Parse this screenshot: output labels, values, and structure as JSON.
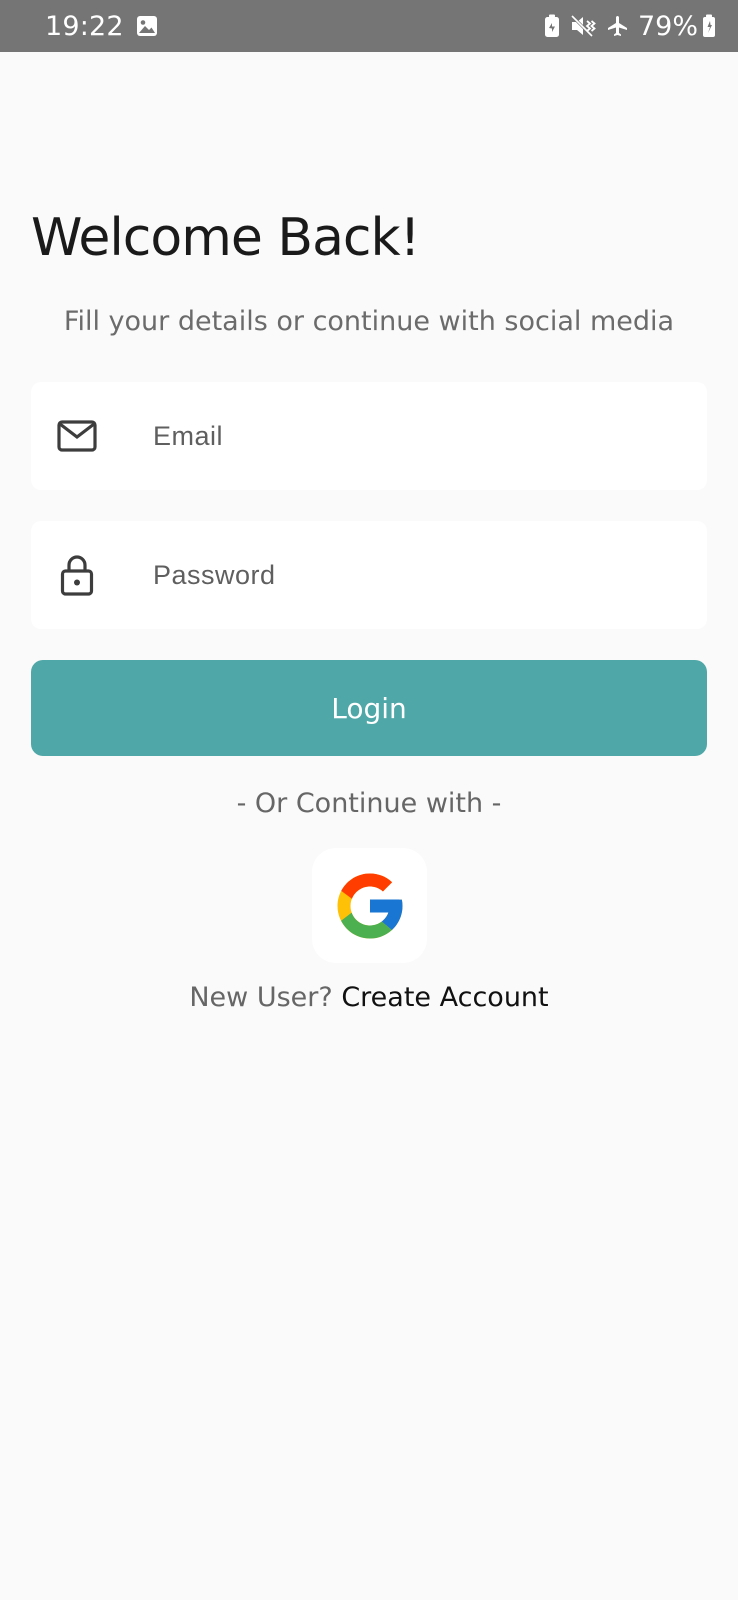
{
  "status_bar": {
    "time": "19:22",
    "battery": "79%",
    "icons": [
      "gallery-icon",
      "battery-saver-icon",
      "vibrate-off-icon",
      "airplane-icon",
      "battery-charging-icon"
    ]
  },
  "login": {
    "title": "Welcome Back!",
    "subtitle": "Fill your details or continue with social media",
    "email_placeholder": "Email",
    "password_placeholder": "Password",
    "login_label": "Login",
    "divider": "- Or Continue with -",
    "signup_prompt": "New User?",
    "signup_link": "Create Account"
  },
  "colors": {
    "accent": "#4fa7a7",
    "background": "#fafafa",
    "status_bar": "#757575"
  }
}
